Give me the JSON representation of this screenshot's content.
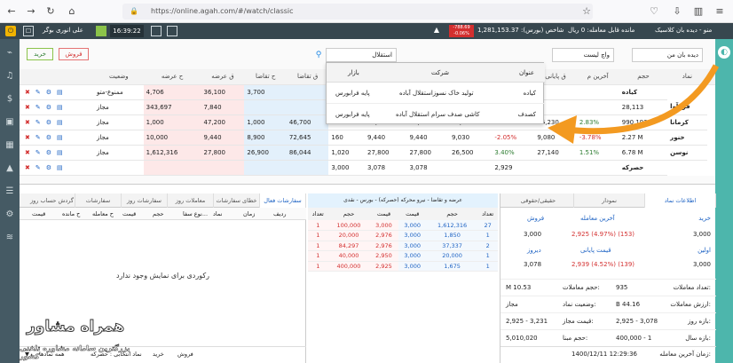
{
  "browser": {
    "url": "https://online.agah.com/#/watch/classic"
  },
  "app": {
    "menu_title": "منو - دیده بان کلاسیک",
    "balance_label": "مانده قابل معامله: 0 ریال",
    "index_label": "شاخص (بورس): 1,281,153.37",
    "index_change": "-788.69",
    "index_change_pct": "-0.06%",
    "time": "16:39:22",
    "user": "علی انوری بوگر"
  },
  "toolbar": {
    "view_select": "دیده بان من",
    "list_select": "واچ لیست",
    "search_value": "استقلال",
    "buy": "خرید",
    "sell": "فروش"
  },
  "search_popup": {
    "headers": [
      "عنوان",
      "شرکت",
      "بازار"
    ],
    "rows": [
      [
        "کیاده",
        "تولید خاک نسوزاستقلال آباده",
        "پایه فرابورس"
      ],
      [
        "کصدف",
        "کاشی صدف سرام استقلال آباده",
        "پایه فرابورس"
      ]
    ]
  },
  "watch": {
    "headers": [
      "نماد",
      "حجم",
      "آخرین م",
      "ق پایانی",
      "",
      "ق آخرین",
      "",
      "حجم",
      "تعداد",
      "ق تقاضا",
      "ح تقاضا",
      "ق عرضه",
      "ح عرضه",
      "وضعیت"
    ],
    "rows": [
      [
        "کیاده",
        "",
        "",
        "",
        "",
        "",
        "",
        "",
        "",
        "",
        "3,700",
        "36,100",
        "4,706",
        "ممنوع-متو"
      ],
      [
        "قن آوا",
        "28,113",
        "",
        "",
        "",
        "",
        "",
        "",
        "",
        "",
        "",
        "",
        "",
        "مجاز"
      ],
      [
        "کرمانا",
        "990,193",
        "",
        "",
        "",
        "",
        "",
        "",
        "",
        "",
        "",
        "",
        "",
        "مجاز"
      ],
      [
        "خنور",
        "2.27 M",
        "-3.78%",
        "",
        "-2.05%",
        "9,030",
        "9,440",
        "47,240",
        "160",
        "",
        "47,200",
        "1,000",
        "",
        "مجاز"
      ],
      [
        "نوسن",
        "6.78 M",
        "1.51%",
        "",
        "3.40%",
        "27,140",
        "26,500",
        "27,800",
        "",
        "72,645",
        "",
        "8,900",
        "10,000",
        "مجاز"
      ],
      [
        "حصرکه",
        "",
        "",
        "",
        "",
        "",
        "",
        "",
        "",
        "",
        "86,044",
        "26,900",
        "7,840",
        "مجاز"
      ]
    ],
    "cells": {
      "r1": [
        "",
        "",
        "",
        "",
        "",
        "",
        "",
        "",
        "3,700",
        "36,100",
        "4,706",
        "ممنوع-متو"
      ],
      "r2": [
        "28,113",
        "",
        "",
        "",
        "",
        "",
        "",
        "",
        "",
        "",
        "7,840",
        "343,697",
        "مجاز"
      ],
      "r3": [
        "990,193",
        "2.83%",
        "46,230",
        "1.02%",
        "45,030",
        "47,240",
        "47,200",
        "160",
        "46,700",
        "1,000",
        "47,200",
        "1,000",
        "مجاز"
      ],
      "r4": [
        "2.27 M",
        "-3.78%",
        "9,080",
        "-2.05%",
        "9,030",
        "9,440",
        "9,440",
        "160",
        "72,645",
        "8,900",
        "9,440",
        "10,000",
        "مجاز"
      ],
      "r5": [
        "6.78 M",
        "1.51%",
        "27,140",
        "3.40%",
        "26,500",
        "27,800",
        "27,800",
        "1,020",
        "86,044",
        "26,900",
        "27,800",
        "1,612,316",
        "مجاز"
      ],
      "r6": [
        "",
        "",
        "2,929",
        "",
        "3,078",
        "3,078",
        "3,000",
        "",
        "",
        "",
        "",
        ""
      ]
    }
  },
  "orders": {
    "tabs": [
      "سفارشات فعال",
      "خطای سفارشات",
      "معاملات روز",
      "سفارشات روز",
      "سفارشات درانت...",
      "گردش حساب روز"
    ],
    "headers": [
      "ردیف",
      "زمان",
      "نماد",
      "نوع سفا...",
      "حجم",
      "قیمت",
      "ح معامله",
      "ح مانده",
      "قیمت"
    ],
    "empty": "رکوردی برای نمایش وجود ندارد",
    "filters": {
      "all": "همه نمادها",
      "selected": "نماد انتخابی : حصرکه",
      "buy": "خرید",
      "sell": "فروش"
    }
  },
  "orderbook": {
    "title": "عرضه و تقاضا - نیرو محرکه (حصرکه) - بورس - نقدی",
    "headers": [
      "تعداد",
      "حجم",
      "قیمت",
      "قیمت",
      "حجم",
      "تعداد"
    ],
    "rows": [
      [
        "1",
        "100,000",
        "3,000",
        "3,000",
        "1,612,316",
        "27"
      ],
      [
        "1",
        "20,000",
        "2,976",
        "3,000",
        "1,850",
        "1"
      ],
      [
        "1",
        "84,297",
        "2,976",
        "3,000",
        "37,337",
        "2"
      ],
      [
        "1",
        "40,000",
        "2,950",
        "3,000",
        "20,000",
        "1"
      ],
      [
        "1",
        "400,000",
        "2,925",
        "3,000",
        "1,675",
        "1"
      ]
    ]
  },
  "info": {
    "tabs": [
      "اطلاعات نماد",
      "نمودار",
      "حقیقی/حقوقی"
    ],
    "buy": "خرید",
    "sell": "فروش",
    "first": "اولین",
    "last_trade": "آخرین معامله",
    "final": "قیمت پایانی",
    "yesterday": "دیروز",
    "buy_val": "3,000",
    "sell_val": "3,000",
    "first_val": "3,000",
    "yesterday_val": "3,078",
    "last_trade_val": "2,925 (4.97%) (153)",
    "final_val": "2,939 (4.52%) (139)",
    "rows": [
      [
        "تعداد معاملات:",
        "935",
        "حجم معاملات:",
        "M 10.53"
      ],
      [
        "ارزش معاملات:",
        "B 44.16",
        "وضعیت نماد:",
        "مجاز"
      ],
      [
        "بازه روز:",
        "2,925 - 3,078",
        "قیمت مجاز:",
        "2,925 - 3,231"
      ],
      [
        "بازه سال:",
        "400,000 - 1",
        "حجم مبنا:",
        "5,010,020"
      ]
    ],
    "time_label": "زمان آخرین معامله:",
    "time_val": "1400/12/11 12:29:36"
  },
  "watermark": {
    "title": "همراه مشاور",
    "subtitle": "بزرگترین سامانه مشاوره تلفنی کشور"
  },
  "colors": {
    "header": "#37474f",
    "accent": "#4db6ac",
    "arrow": "#f39a21"
  }
}
